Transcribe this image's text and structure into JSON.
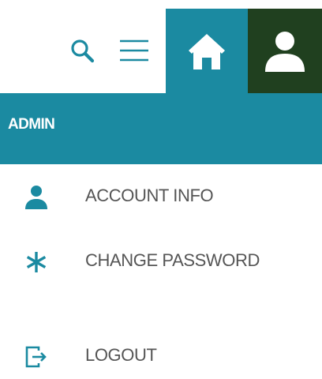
{
  "toolbar": {
    "icons": {
      "search": "search-icon",
      "menu": "hamburger-menu-icon",
      "home": "home-icon",
      "user": "user-icon"
    }
  },
  "admin_bar": {
    "label": "ADMIN"
  },
  "menu": {
    "items": [
      {
        "label": "ACCOUNT INFO",
        "icon": "user-icon"
      },
      {
        "label": "CHANGE PASSWORD",
        "icon": "asterisk-icon"
      },
      {
        "label": "LOGOUT",
        "icon": "logout-icon"
      }
    ]
  },
  "colors": {
    "accent": "#1b8aa1",
    "user_tile": "#20401f",
    "icon": "#1b8aa1",
    "menu_text": "#555555",
    "white": "#ffffff"
  }
}
